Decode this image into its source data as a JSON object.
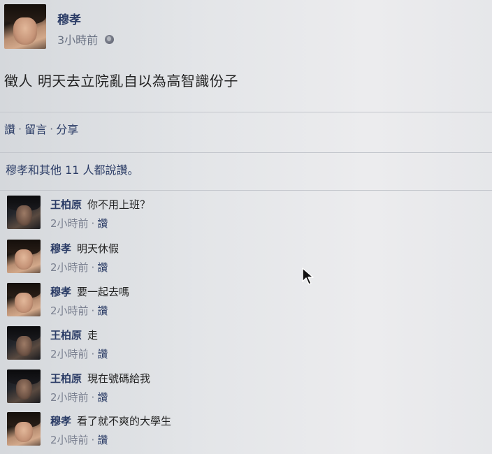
{
  "post": {
    "author": "穆孝",
    "time": "3小時前",
    "text": "徵人 明天去立院亂自以為高智識份子"
  },
  "actions": {
    "like": "讚",
    "comment": "留言",
    "share": "分享",
    "separator": "·"
  },
  "likes_summary": "穆孝和其他 11 人都說讚。",
  "comments": [
    {
      "name": "王柏原",
      "text": "你不用上班？",
      "time": "2小時前",
      "like": "讚",
      "avatar": "dark"
    },
    {
      "name": "穆孝",
      "text": "明天休假",
      "time": "2小時前",
      "like": "讚",
      "avatar": "light"
    },
    {
      "name": "穆孝",
      "text": "要一起去嗎",
      "time": "2小時前",
      "like": "讚",
      "avatar": "light"
    },
    {
      "name": "王柏原",
      "text": "走",
      "time": "2小時前",
      "like": "讚",
      "avatar": "dark"
    },
    {
      "name": "王柏原",
      "text": "現在號碼給我",
      "time": "2小時前",
      "like": "讚",
      "avatar": "dark"
    },
    {
      "name": "穆孝",
      "text": "看了就不爽的大學生",
      "time": "2小時前",
      "like": "讚",
      "avatar": "light"
    }
  ],
  "icons": {
    "privacy": "globe-icon",
    "pointer": "mouse-cursor-icon"
  },
  "colors": {
    "link": "#2b3c66",
    "meta": "#6b7384",
    "background": "#e3e5e8"
  }
}
